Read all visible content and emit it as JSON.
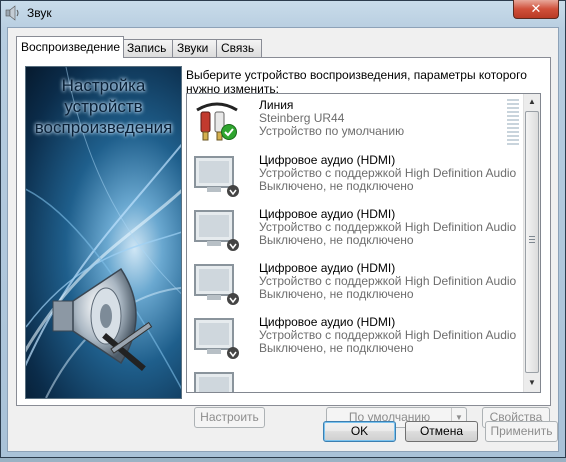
{
  "window": {
    "title": "Звук",
    "close_label": "✕"
  },
  "tabs": [
    {
      "label": "Воспроизведение",
      "active": true
    },
    {
      "label": "Запись",
      "active": false
    },
    {
      "label": "Звуки",
      "active": false
    },
    {
      "label": "Связь",
      "active": false
    }
  ],
  "banner": {
    "line1": "Настройка",
    "line2": "устройств",
    "line3": "воспроизведения"
  },
  "instruction": "Выберите устройство воспроизведения, параметры которого нужно изменить:",
  "devices": [
    {
      "name": "Линия",
      "detail": "Steinberg UR44",
      "status": "Устройство по умолчанию",
      "icon": "line-in-cable-icon",
      "default": true
    },
    {
      "name": "Цифровое аудио (HDMI)",
      "detail": "Устройство с поддержкой High Definition Audio",
      "status": "Выключено, не подключено",
      "icon": "monitor-icon",
      "default": false
    },
    {
      "name": "Цифровое аудио (HDMI)",
      "detail": "Устройство с поддержкой High Definition Audio",
      "status": "Выключено, не подключено",
      "icon": "monitor-icon",
      "default": false
    },
    {
      "name": "Цифровое аудио (HDMI)",
      "detail": "Устройство с поддержкой High Definition Audio",
      "status": "Выключено, не подключено",
      "icon": "monitor-icon",
      "default": false
    },
    {
      "name": "Цифровое аудио (HDMI)",
      "detail": "Устройство с поддержкой High Definition Audio",
      "status": "Выключено, не подключено",
      "icon": "monitor-icon",
      "default": false
    }
  ],
  "panel_buttons": {
    "configure": "Настроить",
    "set_default": "По умолчанию",
    "properties": "Свойства"
  },
  "dialog_buttons": {
    "ok": "OK",
    "cancel": "Отмена",
    "apply": "Применить"
  },
  "colors": {
    "accent_check": "#2fa52f",
    "disabled_text": "#8d8d8d"
  }
}
